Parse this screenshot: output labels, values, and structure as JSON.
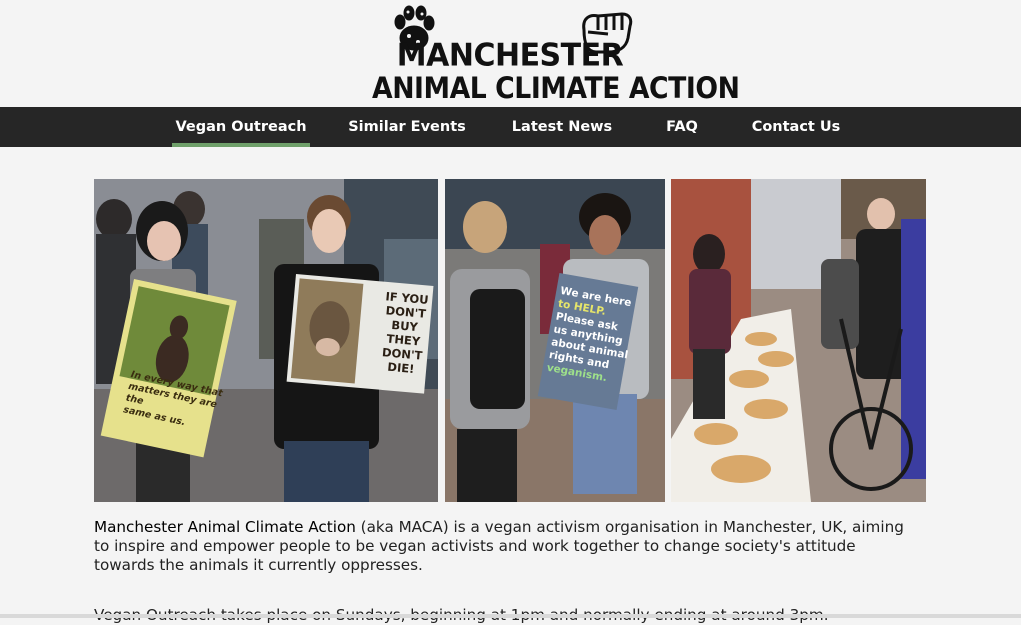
{
  "logo": {
    "line1": "MANCHESTER",
    "line2": "ANIMAL CLIMATE ACTION"
  },
  "nav": {
    "items": [
      {
        "label": "Vegan Outreach",
        "active": true
      },
      {
        "label": "Similar Events",
        "active": false
      },
      {
        "label": "Latest News",
        "active": false
      },
      {
        "label": "FAQ",
        "active": false
      },
      {
        "label": "Contact Us",
        "active": false
      }
    ],
    "active_color": "#6fa06a",
    "bar_color": "#262626"
  },
  "photos": {
    "sign1": [
      "In every way that",
      "matters they are the",
      "same as us."
    ],
    "sign2": [
      "IF YOU",
      "DON'T BUY",
      "THEY",
      "DON'T DIE!"
    ],
    "sign3": [
      "We are here",
      "to HELP.",
      "Please ask",
      "us anything",
      "about animal",
      "rights and",
      "veganism."
    ]
  },
  "intro": {
    "brand": "Manchester Animal Climate Action",
    "rest": " (aka MACA) is a vegan activism organisation in Manchester, UK, aiming to inspire and empower people to be vegan activists and work together to change society's attitude towards the animals it currently oppresses."
  },
  "second_paragraph": "Vegan Outreach takes place on Sundays, beginning at 1pm and normally ending at around 3pm."
}
